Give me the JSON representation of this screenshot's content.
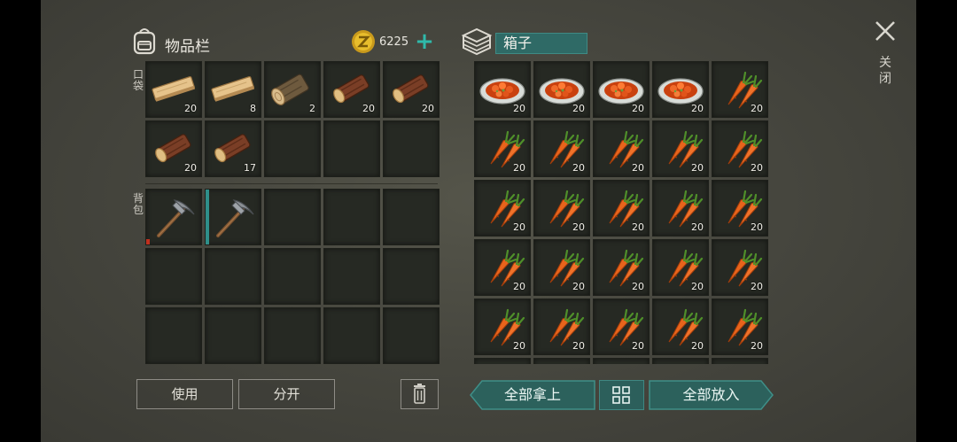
{
  "inventory": {
    "title": "物品栏",
    "coins": "6225",
    "add_coins_label": "+",
    "pocket_label": "口袋",
    "backpack_label": "背包",
    "pocket_slots": [
      {
        "item": "plank-icon",
        "qty": "20"
      },
      {
        "item": "plank-icon",
        "qty": "8"
      },
      {
        "item": "log-icon",
        "qty": "2"
      },
      {
        "item": "wood-log-icon",
        "qty": "20"
      },
      {
        "item": "wood-log-icon",
        "qty": "20"
      },
      {
        "item": "wood-log-icon",
        "qty": "20"
      },
      {
        "item": "wood-log-icon",
        "qty": "17"
      },
      {
        "item": "",
        "qty": ""
      },
      {
        "item": "",
        "qty": ""
      },
      {
        "item": "",
        "qty": ""
      }
    ],
    "backpack_slots": [
      {
        "item": "pickaxe-icon",
        "qty": "",
        "durability_color": "#c0301f"
      },
      {
        "item": "pickaxe-icon",
        "qty": "",
        "durability_color": "#2f8f8a"
      },
      {
        "item": "",
        "qty": ""
      },
      {
        "item": "",
        "qty": ""
      },
      {
        "item": "",
        "qty": ""
      },
      {
        "item": "",
        "qty": ""
      },
      {
        "item": "",
        "qty": ""
      },
      {
        "item": "",
        "qty": ""
      },
      {
        "item": "",
        "qty": ""
      },
      {
        "item": "",
        "qty": ""
      },
      {
        "item": "",
        "qty": ""
      },
      {
        "item": "",
        "qty": ""
      },
      {
        "item": "",
        "qty": ""
      },
      {
        "item": "",
        "qty": ""
      },
      {
        "item": "",
        "qty": ""
      }
    ]
  },
  "chest": {
    "title": "箱子",
    "slots": [
      {
        "item": "stew-plate-icon",
        "qty": "20"
      },
      {
        "item": "stew-plate-icon",
        "qty": "20"
      },
      {
        "item": "stew-plate-icon",
        "qty": "20"
      },
      {
        "item": "stew-plate-icon",
        "qty": "20"
      },
      {
        "item": "carrot-icon",
        "qty": "20"
      },
      {
        "item": "carrot-icon",
        "qty": "20"
      },
      {
        "item": "carrot-icon",
        "qty": "20"
      },
      {
        "item": "carrot-icon",
        "qty": "20"
      },
      {
        "item": "carrot-icon",
        "qty": "20"
      },
      {
        "item": "carrot-icon",
        "qty": "20"
      },
      {
        "item": "carrot-icon",
        "qty": "20"
      },
      {
        "item": "carrot-icon",
        "qty": "20"
      },
      {
        "item": "carrot-icon",
        "qty": "20"
      },
      {
        "item": "carrot-icon",
        "qty": "20"
      },
      {
        "item": "carrot-icon",
        "qty": "20"
      },
      {
        "item": "carrot-icon",
        "qty": "20"
      },
      {
        "item": "carrot-icon",
        "qty": "20"
      },
      {
        "item": "carrot-icon",
        "qty": "20"
      },
      {
        "item": "carrot-icon",
        "qty": "20"
      },
      {
        "item": "carrot-icon",
        "qty": "20"
      },
      {
        "item": "carrot-icon",
        "qty": "20"
      },
      {
        "item": "carrot-icon",
        "qty": "20"
      },
      {
        "item": "carrot-icon",
        "qty": "20"
      },
      {
        "item": "carrot-icon",
        "qty": "20"
      },
      {
        "item": "carrot-icon",
        "qty": "20"
      },
      {
        "item": "",
        "qty": ""
      },
      {
        "item": "",
        "qty": ""
      },
      {
        "item": "",
        "qty": ""
      },
      {
        "item": "",
        "qty": ""
      },
      {
        "item": "",
        "qty": ""
      }
    ]
  },
  "close_label": "关闭",
  "buttons": {
    "use": "使用",
    "split": "分开",
    "take_all": "全部拿上",
    "put_all": "全部放入"
  },
  "colors": {
    "accent_teal": "#2fb9aa",
    "button_teal": "#2c615c"
  }
}
